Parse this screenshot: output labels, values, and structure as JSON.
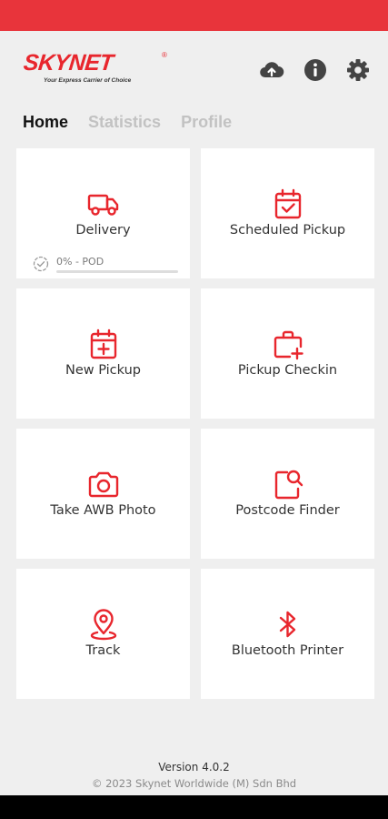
{
  "colors": {
    "brand_red": "#e8262d",
    "status_red": "#e8343b",
    "tile_bg": "#ffffff",
    "page_bg": "#efefef"
  },
  "header": {
    "logo_text": "SKYNET",
    "logo_tagline": "Your Express Carrier of Choice",
    "logo_registered": "®",
    "icons": [
      "cloud-upload-icon",
      "info-icon",
      "gear-icon"
    ]
  },
  "tabs": [
    {
      "label": "Home",
      "active": true
    },
    {
      "label": "Statistics",
      "active": false
    },
    {
      "label": "Profile",
      "active": false
    }
  ],
  "tiles": [
    {
      "label": "Delivery",
      "icon": "truck-icon"
    },
    {
      "label": "Scheduled Pickup",
      "icon": "calendar-check-icon"
    },
    {
      "label": "New Pickup",
      "icon": "calendar-plus-icon"
    },
    {
      "label": "Pickup Checkin",
      "icon": "briefcase-plus-icon"
    },
    {
      "label": "Take AWB Photo",
      "icon": "camera-icon"
    },
    {
      "label": "Postcode Finder",
      "icon": "document-search-icon"
    },
    {
      "label": "Track",
      "icon": "location-pin-icon"
    },
    {
      "label": "Bluetooth Printer",
      "icon": "bluetooth-icon"
    }
  ],
  "delivery_progress": {
    "text": "0% - POD",
    "percent": 0
  },
  "footer": {
    "version": "Version 4.0.2",
    "copyright": "© 2023 Skynet Worldwide (M) Sdn Bhd"
  }
}
